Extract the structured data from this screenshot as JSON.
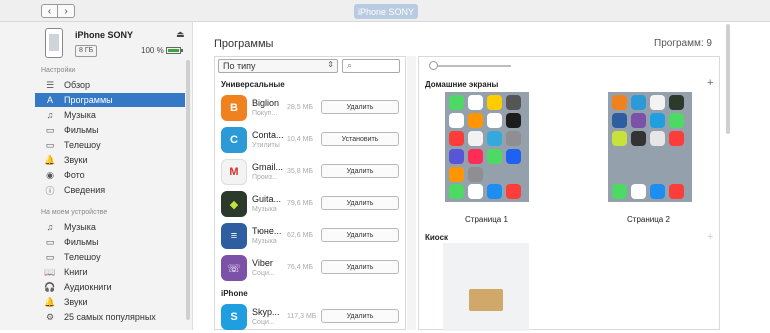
{
  "toolbar": {
    "back": "‹",
    "forward": "›",
    "device_pill": "iPhone SONY"
  },
  "device": {
    "name": "iPhone SONY",
    "capacity": "8 ГБ",
    "battery": "100 %",
    "eject": "⏏"
  },
  "sidebar": {
    "settings_title": "Настройки",
    "settings_items": [
      {
        "label": "Обзор",
        "icon": "☰"
      },
      {
        "label": "Программы",
        "icon": "A"
      },
      {
        "label": "Музыка",
        "icon": "♫"
      },
      {
        "label": "Фильмы",
        "icon": "▭"
      },
      {
        "label": "Телешоу",
        "icon": "▭"
      },
      {
        "label": "Звуки",
        "icon": "🔔"
      },
      {
        "label": "Фото",
        "icon": "◉"
      },
      {
        "label": "Сведения",
        "icon": "ⓘ"
      }
    ],
    "device_title": "На моем устройстве",
    "device_items": [
      {
        "label": "Музыка",
        "icon": "♫"
      },
      {
        "label": "Фильмы",
        "icon": "▭"
      },
      {
        "label": "Телешоу",
        "icon": "▭"
      },
      {
        "label": "Книги",
        "icon": "📖"
      },
      {
        "label": "Аудиокниги",
        "icon": "🎧"
      },
      {
        "label": "Звуки",
        "icon": "🔔"
      },
      {
        "label": "25 самых популярных",
        "icon": "⚙"
      }
    ]
  },
  "main": {
    "title": "Программы",
    "count": "Программ: 9",
    "sort": "По типу",
    "group_universal": "Универсальные",
    "group_iphone": "iPhone",
    "apps": [
      {
        "name": "Biglion",
        "category": "Покуп...",
        "size": "28,5 МБ",
        "button": "Удалить",
        "color": "#f0811f"
      },
      {
        "name": "Conta...",
        "category": "Утилиты",
        "size": "10,4 МБ",
        "button": "Установить",
        "color": "#2b9ad7"
      },
      {
        "name": "Gmail...",
        "category": "Произ...",
        "size": "35,8 МБ",
        "button": "Удалить",
        "color": "#f3f3f3"
      },
      {
        "name": "Guita...",
        "category": "Музыка",
        "size": "79,6 МБ",
        "button": "Удалить",
        "color": "#2b3a2b"
      },
      {
        "name": "Тюне...",
        "category": "Музыка",
        "size": "62,6 МБ",
        "button": "Удалить",
        "color": "#2e5ea0"
      },
      {
        "name": "Viber",
        "category": "Соци...",
        "size": "76,4 МБ",
        "button": "Удалить",
        "color": "#7b52a8"
      },
      {
        "name": "Skyp...",
        "category": "Соци...",
        "size": "117,3 МБ",
        "button": "Удалить",
        "color": "#1f9fe0"
      }
    ],
    "home_screens_title": "Домашние экраны",
    "plus": "+",
    "pages": [
      "Страница 1",
      "Страница 2"
    ],
    "kiosk_title": "Киоск"
  }
}
